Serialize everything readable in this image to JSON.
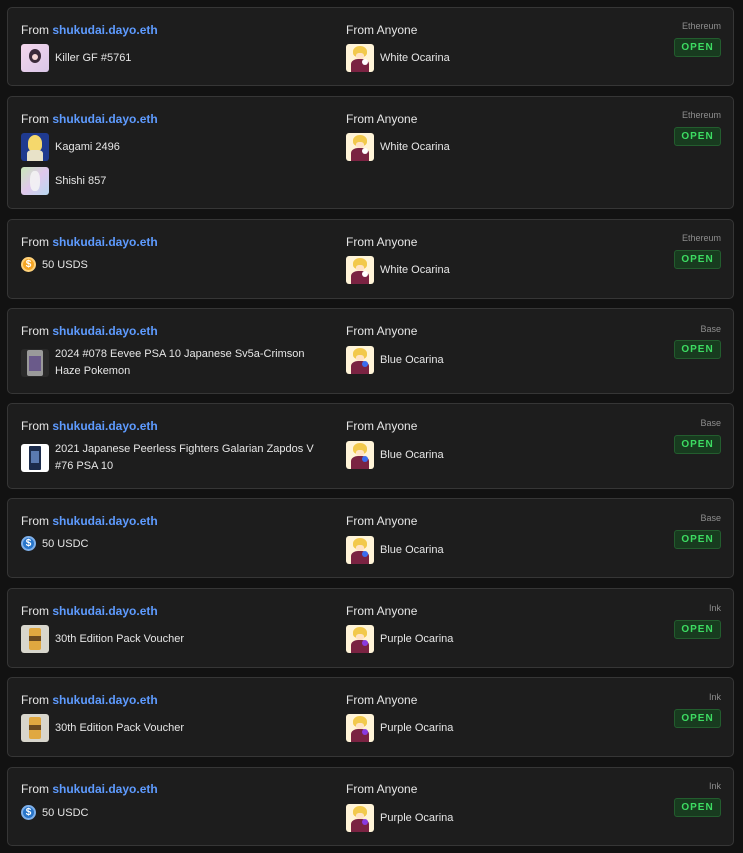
{
  "colors": {
    "username": "#5e9bff",
    "status_text": "#3ddc62",
    "status_bg": "#183b1f",
    "card_bg": "#1d1d1d",
    "page_bg": "#121212"
  },
  "listings": [
    {
      "from_prefix": "From",
      "from_user": "shukudai.dayo.eth",
      "offer": [
        {
          "kind": "nft",
          "icon": "killer-gf-thumbnail",
          "label": "Killer GF #5761"
        }
      ],
      "want_prefix": "From",
      "want_user": "Anyone",
      "want": {
        "icon": "white-ocarina-thumbnail",
        "label": "White Ocarina"
      },
      "chain": "Ethereum",
      "status": "OPEN"
    },
    {
      "from_prefix": "From",
      "from_user": "shukudai.dayo.eth",
      "offer": [
        {
          "kind": "nft",
          "icon": "kagami-thumbnail",
          "label": "Kagami 2496"
        },
        {
          "kind": "nft",
          "icon": "shishi-thumbnail",
          "label": "Shishi 857"
        }
      ],
      "want_prefix": "From",
      "want_user": "Anyone",
      "want": {
        "icon": "white-ocarina-thumbnail",
        "label": "White Ocarina"
      },
      "chain": "Ethereum",
      "status": "OPEN"
    },
    {
      "from_prefix": "From",
      "from_user": "shukudai.dayo.eth",
      "offer": [
        {
          "kind": "coin",
          "icon": "usds-coin-icon",
          "label": "50 USDS"
        }
      ],
      "want_prefix": "From",
      "want_user": "Anyone",
      "want": {
        "icon": "white-ocarina-thumbnail",
        "label": "White Ocarina"
      },
      "chain": "Ethereum",
      "status": "OPEN"
    },
    {
      "from_prefix": "From",
      "from_user": "shukudai.dayo.eth",
      "offer": [
        {
          "kind": "nft",
          "icon": "eevee-psa-card-thumbnail",
          "label": "2024 #078 Eevee PSA 10 Japanese Sv5a-Crimson Haze Pokemon"
        }
      ],
      "want_prefix": "From",
      "want_user": "Anyone",
      "want": {
        "icon": "blue-ocarina-thumbnail",
        "label": "Blue Ocarina"
      },
      "chain": "Base",
      "status": "OPEN"
    },
    {
      "from_prefix": "From",
      "from_user": "shukudai.dayo.eth",
      "offer": [
        {
          "kind": "nft",
          "icon": "zapdos-psa-card-thumbnail",
          "label": "2021 Japanese Peerless Fighters Galarian Zapdos V #76 PSA 10"
        }
      ],
      "want_prefix": "From",
      "want_user": "Anyone",
      "want": {
        "icon": "blue-ocarina-thumbnail",
        "label": "Blue Ocarina"
      },
      "chain": "Base",
      "status": "OPEN"
    },
    {
      "from_prefix": "From",
      "from_user": "shukudai.dayo.eth",
      "offer": [
        {
          "kind": "coin",
          "icon": "usdc-coin-icon",
          "label": "50 USDC"
        }
      ],
      "want_prefix": "From",
      "want_user": "Anyone",
      "want": {
        "icon": "blue-ocarina-thumbnail",
        "label": "Blue Ocarina"
      },
      "chain": "Base",
      "status": "OPEN"
    },
    {
      "from_prefix": "From",
      "from_user": "shukudai.dayo.eth",
      "offer": [
        {
          "kind": "nft",
          "icon": "pack-voucher-thumbnail",
          "label": "30th Edition Pack Voucher"
        }
      ],
      "want_prefix": "From",
      "want_user": "Anyone",
      "want": {
        "icon": "purple-ocarina-thumbnail",
        "label": "Purple Ocarina"
      },
      "chain": "Ink",
      "status": "OPEN"
    },
    {
      "from_prefix": "From",
      "from_user": "shukudai.dayo.eth",
      "offer": [
        {
          "kind": "nft",
          "icon": "pack-voucher-thumbnail",
          "label": "30th Edition Pack Voucher"
        }
      ],
      "want_prefix": "From",
      "want_user": "Anyone",
      "want": {
        "icon": "purple-ocarina-thumbnail",
        "label": "Purple Ocarina"
      },
      "chain": "Ink",
      "status": "OPEN"
    },
    {
      "from_prefix": "From",
      "from_user": "shukudai.dayo.eth",
      "offer": [
        {
          "kind": "coin",
          "icon": "usdc-coin-icon",
          "label": "50 USDC"
        }
      ],
      "want_prefix": "From",
      "want_user": "Anyone",
      "want": {
        "icon": "purple-ocarina-thumbnail",
        "label": "Purple Ocarina"
      },
      "chain": "Ink",
      "status": "OPEN"
    }
  ]
}
